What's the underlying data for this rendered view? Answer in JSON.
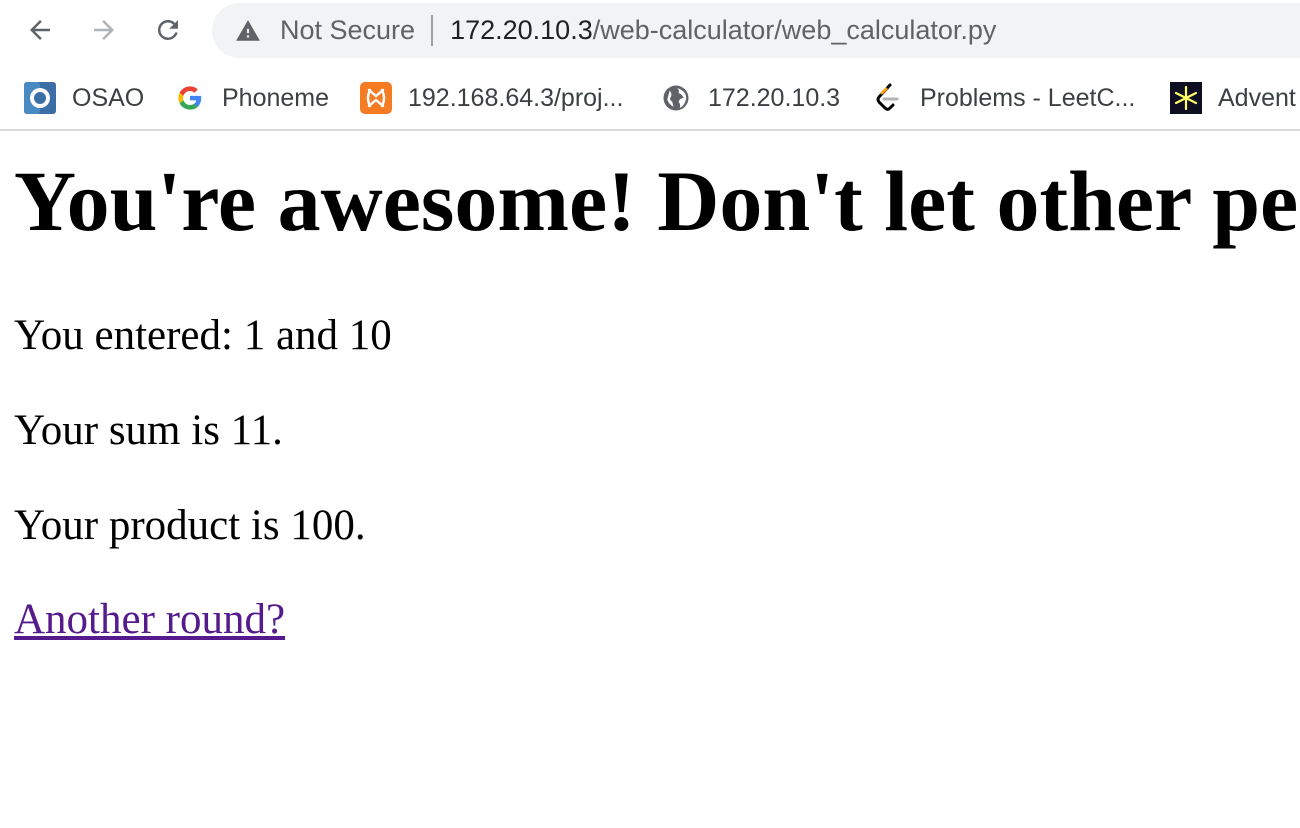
{
  "toolbar": {
    "back_icon": "arrow-left-icon",
    "forward_icon": "arrow-right-icon",
    "reload_icon": "reload-icon",
    "security_icon": "warning-triangle-icon",
    "security_label": "Not Secure",
    "url_host": "172.20.10.3",
    "url_path": "/web-calculator/web_calculator.py"
  },
  "bookmarks": {
    "items": [
      {
        "label": "OSAO",
        "icon": "osao-favicon"
      },
      {
        "label": "Phoneme",
        "icon": "google-favicon"
      },
      {
        "label": "192.168.64.3/proj...",
        "icon": "xampp-favicon"
      },
      {
        "label": "172.20.10.3",
        "icon": "globe-icon"
      },
      {
        "label": "Problems - LeetC...",
        "icon": "leetcode-favicon"
      },
      {
        "label": "Advent",
        "icon": "advent-star-favicon"
      }
    ]
  },
  "page": {
    "heading": "You're awesome! Don't let other pe",
    "entered": "You entered: 1 and 10",
    "sum": "Your sum is 11.",
    "product": "Your product is 100.",
    "link": "Another round?"
  },
  "colors": {
    "omnibox_bg": "#f1f3f4",
    "visited_link": "#551a8b",
    "divider": "#dadce0"
  }
}
